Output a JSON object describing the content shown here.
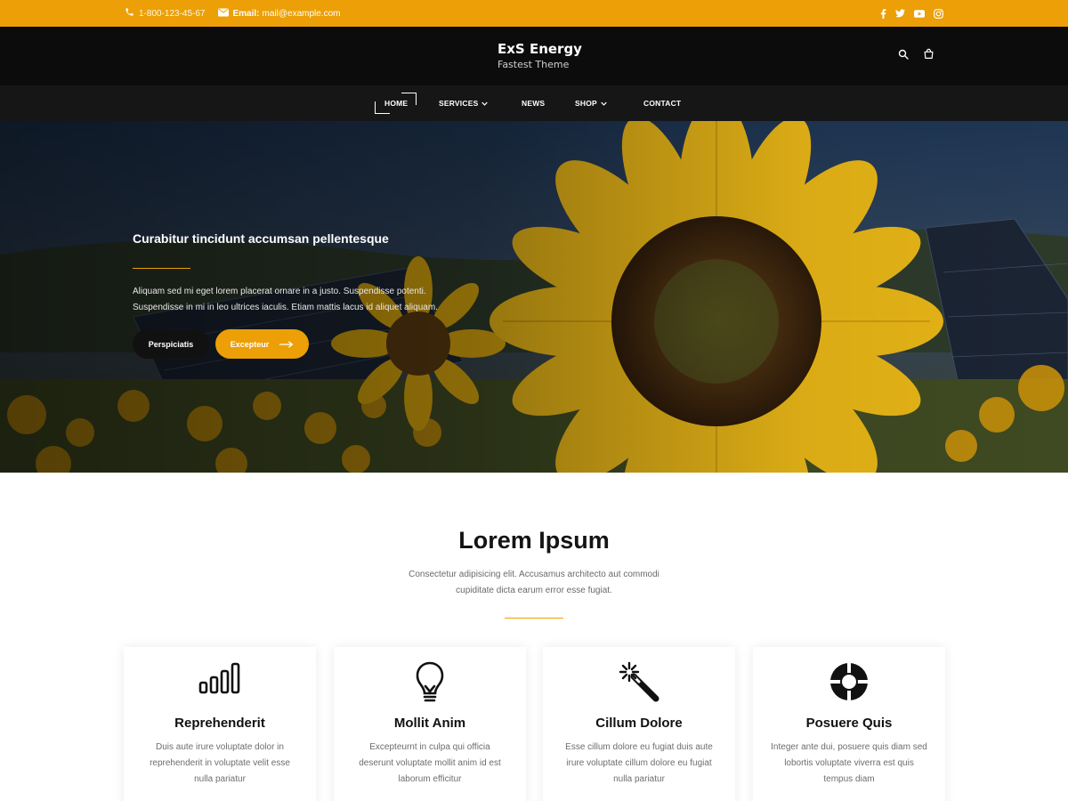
{
  "topbar": {
    "phone": "1-800-123-45-67",
    "email_label": "Email:",
    "email": "mail@example.com",
    "icons": [
      "phone-icon",
      "mail-icon",
      "facebook-icon",
      "twitter-icon",
      "youtube-icon",
      "instagram-icon"
    ]
  },
  "header": {
    "site_name": "ExS Energy",
    "tagline": "Fastest Theme",
    "icons": [
      "search-icon",
      "shopping-bag-icon"
    ]
  },
  "nav": {
    "home": "HOME",
    "services": "SERVICES",
    "news": "NEWS",
    "shop": "SHOP",
    "contact": "CONTACT"
  },
  "hero": {
    "title": "Curabitur tincidunt accumsan pellentesque",
    "text": "Aliquam sed mi eget lorem placerat ornare in a justo. Suspendisse potenti. Suspendisse in mi in leo ultrices iaculis. Etiam mattis lacus id aliquet aliquam.",
    "button_primary": "Perspiciatis",
    "button_secondary": "Excepteur"
  },
  "section": {
    "title": "Lorem Ipsum",
    "text": "Consectetur adipisicing elit. Accusamus architecto aut commodi cupiditate dicta earum error esse fugiat."
  },
  "cards": [
    {
      "icon": "signal-bars-icon",
      "title": "Reprehenderit",
      "text": "Duis aute irure voluptate dolor in reprehenderit in voluptate velit esse nulla pariatur"
    },
    {
      "icon": "lightbulb-icon",
      "title": "Mollit Anim",
      "text": "Excepteurnt in culpa qui officia deserunt voluptate mollit anim id est laborum efficitur"
    },
    {
      "icon": "magic-wand-icon",
      "title": "Cillum Dolore",
      "text": "Esse cillum dolore eu fugiat duis aute irure voluptate cillum dolore eu fugiat nulla pariatur"
    },
    {
      "icon": "lifebuoy-icon",
      "title": "Posuere Quis",
      "text": "Integer ante dui, posuere quis diam sed lobortis voluptate viverra est quis tempus diam"
    }
  ],
  "colors": {
    "accent": "#ec9f06",
    "header_bg": "#0c0c0c",
    "nav_bg": "#161616"
  }
}
